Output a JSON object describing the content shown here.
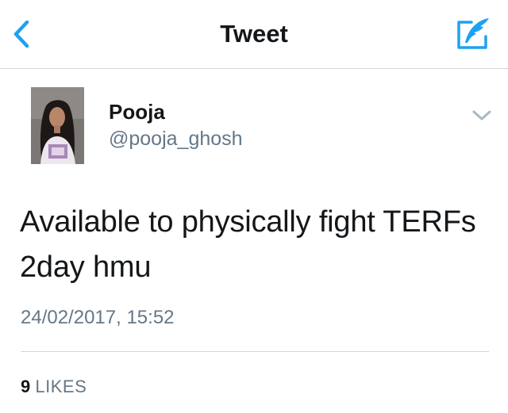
{
  "colors": {
    "accent": "#1da1f2",
    "text": "#14171a",
    "secondary_text": "#657786",
    "divider": "#d0d6db"
  },
  "navbar": {
    "title": "Tweet",
    "back_icon": "chevron-left-icon",
    "compose_icon": "compose-tweet-icon"
  },
  "tweet": {
    "author": {
      "name": "Pooja",
      "handle": "@pooja_ghosh"
    },
    "menu_icon": "chevron-down-icon",
    "text": "Available to physically fight TERFs 2day hmu",
    "timestamp": "24/02/2017, 15:52",
    "stats": {
      "likes_count": "9",
      "likes_label": "LIKES"
    }
  }
}
